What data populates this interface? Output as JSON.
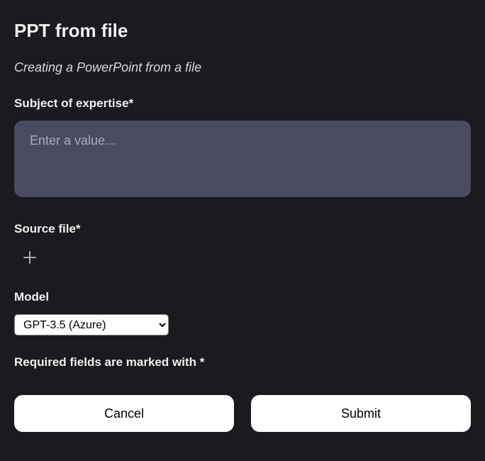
{
  "title": "PPT from file",
  "subtitle": "Creating a PowerPoint from a file",
  "fields": {
    "subject": {
      "label": "Subject of expertise*",
      "placeholder": "Enter a value...",
      "value": ""
    },
    "source_file": {
      "label": "Source file*"
    },
    "model": {
      "label": "Model",
      "selected": "GPT-3.5 (Azure)"
    }
  },
  "required_note": "Required fields are marked with *",
  "buttons": {
    "cancel": "Cancel",
    "submit": "Submit"
  }
}
